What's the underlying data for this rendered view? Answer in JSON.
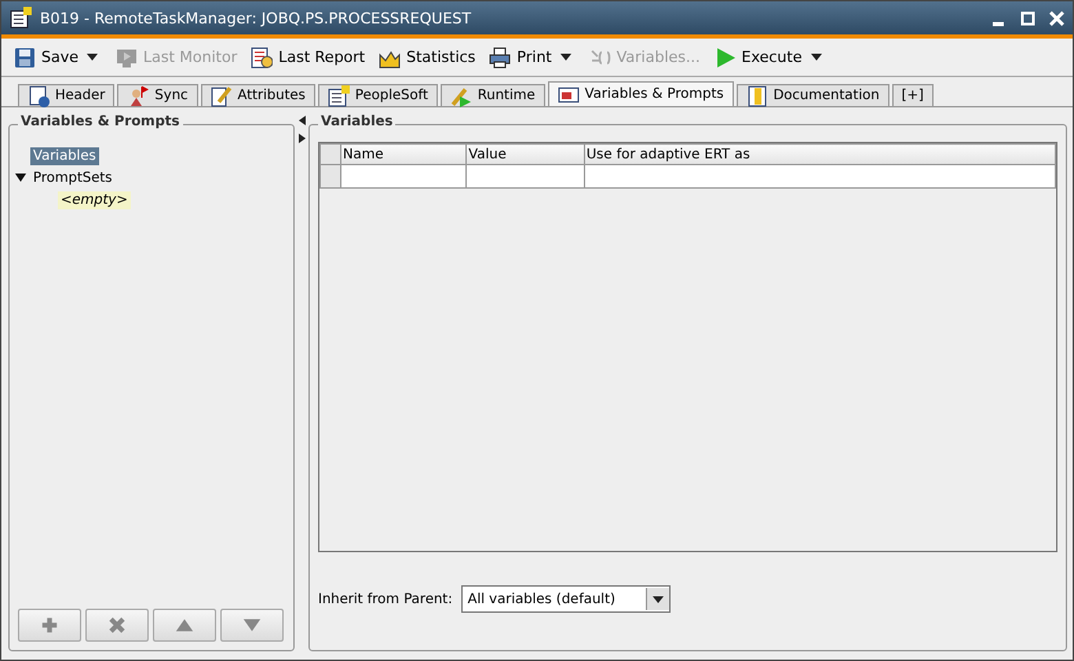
{
  "window": {
    "title": "B019 - RemoteTaskManager: JOBQ.PS.PROCESSREQUEST"
  },
  "toolbar": [
    {
      "kind": "save",
      "label": "Save",
      "disabled": false,
      "dropdown": true
    },
    {
      "kind": "monitor",
      "label": "Last Monitor",
      "disabled": true,
      "dropdown": false
    },
    {
      "kind": "report",
      "label": "Last Report",
      "disabled": false,
      "dropdown": false
    },
    {
      "kind": "statistics",
      "label": "Statistics",
      "disabled": false,
      "dropdown": false
    },
    {
      "kind": "print",
      "label": "Print",
      "disabled": false,
      "dropdown": true
    },
    {
      "kind": "variables",
      "label": "Variables...",
      "disabled": true,
      "dropdown": false
    },
    {
      "kind": "execute",
      "label": "Execute",
      "disabled": false,
      "dropdown": true
    }
  ],
  "tabs": [
    {
      "kind": "header",
      "label": "Header",
      "selected": false
    },
    {
      "kind": "sync",
      "label": "Sync",
      "selected": false
    },
    {
      "kind": "attributes",
      "label": "Attributes",
      "selected": false
    },
    {
      "kind": "peoplesoft",
      "label": "PeopleSoft",
      "selected": false
    },
    {
      "kind": "runtime",
      "label": "Runtime",
      "selected": false
    },
    {
      "kind": "variables",
      "label": "Variables & Prompts",
      "selected": true
    },
    {
      "kind": "documentation",
      "label": "Documentation",
      "selected": false
    },
    {
      "kind": "add",
      "label": "[+]",
      "selected": false
    }
  ],
  "left_panel": {
    "title": "Variables & Prompts",
    "tree": [
      {
        "label": "Variables",
        "selected": true,
        "kind": "node"
      },
      {
        "label": "PromptSets",
        "selected": false,
        "kind": "node",
        "expanded": true,
        "children": [
          {
            "label": "<empty>",
            "selected": false,
            "kind": "placeholder"
          }
        ]
      }
    ],
    "buttons": [
      {
        "kind": "add"
      },
      {
        "kind": "delete"
      },
      {
        "kind": "up"
      },
      {
        "kind": "down"
      }
    ]
  },
  "right_panel": {
    "title": "Variables",
    "table": {
      "columns": [
        "Name",
        "Value",
        "Use for adaptive ERT as"
      ],
      "rows": [
        [
          "",
          "",
          ""
        ]
      ]
    },
    "inherit": {
      "label": "Inherit from Parent:",
      "value": "All variables (default)"
    }
  }
}
